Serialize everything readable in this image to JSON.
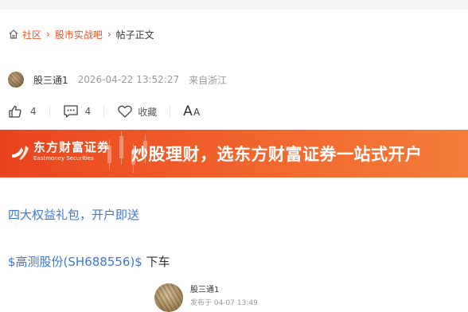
{
  "breadcrumb": {
    "items": [
      "社区",
      "股市实战吧"
    ],
    "current": "帖子正文"
  },
  "author": {
    "name": "股三通1",
    "time": "2026-04-22 13:52:27",
    "location": "来自浙江"
  },
  "actions": {
    "like_count": "4",
    "comment_count": "4",
    "favorite_label": "收藏",
    "font_big": "A",
    "font_small": "A"
  },
  "banner": {
    "brand_cn": "东方财富证券",
    "brand_en": "Eastmoney Securities",
    "slogan": "炒股理财，选东方财富证券一站式开户"
  },
  "content": {
    "promo_link": "四大权益礼包，开户即送",
    "stock_link": "$高测股份(SH688556)$",
    "stock_text": " 下车"
  },
  "quote": {
    "name": "股三通1",
    "time": "发布于 04-07 13:49"
  },
  "colors": {
    "accent": "#e4582a",
    "link": "#3b78d8",
    "banner": "#f0602a"
  }
}
